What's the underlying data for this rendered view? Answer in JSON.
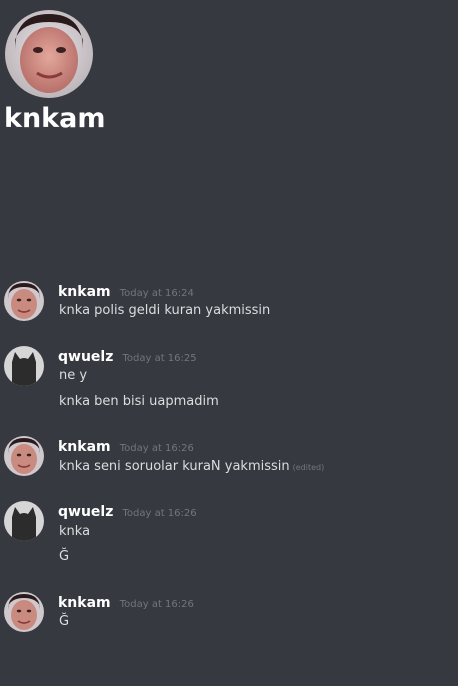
{
  "channel": {
    "title": "knkam"
  },
  "messages": [
    {
      "username": "knkam",
      "timestamp": "Today at 16:24",
      "lines": [
        {
          "text": "knka polis geldi kuran yakmissin",
          "edited": ""
        }
      ]
    },
    {
      "username": "qwuelz",
      "timestamp": "Today at 16:25",
      "lines": [
        {
          "text": "ne y",
          "edited": ""
        },
        {
          "text": "knka ben bisi uapmadim",
          "edited": ""
        }
      ]
    },
    {
      "username": "knkam",
      "timestamp": "Today at 16:26",
      "lines": [
        {
          "text": "knka seni soruolar kuraN yakmissin",
          "edited": "(edited)"
        }
      ]
    },
    {
      "username": "qwuelz",
      "timestamp": "Today at 16:26",
      "lines": [
        {
          "text": "knka",
          "edited": ""
        },
        {
          "text": "Ğ",
          "edited": ""
        }
      ]
    },
    {
      "username": "knkam",
      "timestamp": "Today at 16:26",
      "lines": [
        {
          "text": "Ğ",
          "edited": ""
        }
      ]
    }
  ],
  "colors": {
    "background": "#36393f",
    "username": "#ffffff",
    "message_text": "#dcddde",
    "timestamp": "#72767d"
  },
  "icons": {
    "knkam_avatar": "face-photo-avatar-icon",
    "qwuelz_avatar": "cat-silhouette-avatar-icon"
  }
}
